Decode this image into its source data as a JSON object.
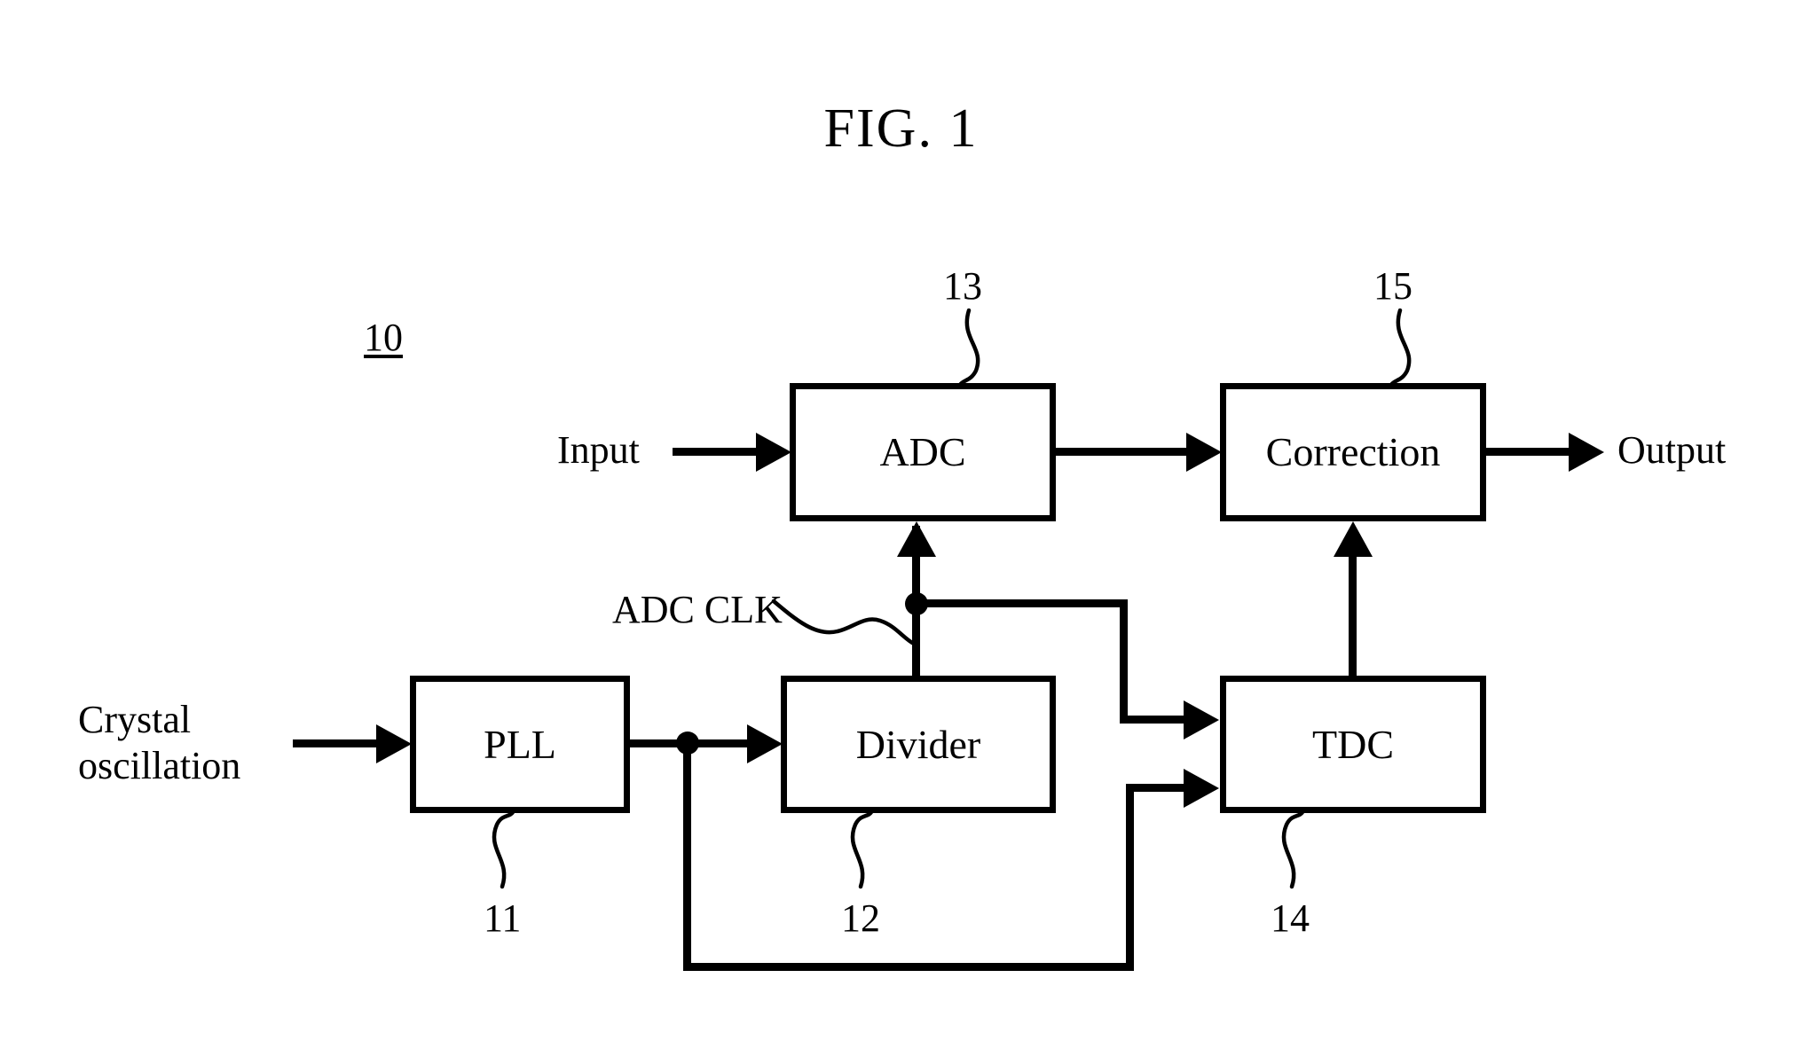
{
  "figure": {
    "title": "FIG. 1",
    "assembly_numeral": "10"
  },
  "blocks": [
    {
      "id": "pll",
      "label": "PLL",
      "ref": "11"
    },
    {
      "id": "divider",
      "label": "Divider",
      "ref": "12"
    },
    {
      "id": "adc",
      "label": "ADC",
      "ref": "13"
    },
    {
      "id": "tdc",
      "label": "TDC",
      "ref": "14"
    },
    {
      "id": "correction",
      "label": "Correction",
      "ref": "15"
    }
  ],
  "labels": {
    "input": "Input",
    "output": "Output",
    "crystal_oscillation": "Crystal\noscillation",
    "adc_clk": "ADC CLK"
  },
  "refs": {
    "pll": "11",
    "divider": "12",
    "adc": "13",
    "tdc": "14",
    "correction": "15"
  },
  "colors": {
    "line": "#000000",
    "background": "#ffffff"
  }
}
